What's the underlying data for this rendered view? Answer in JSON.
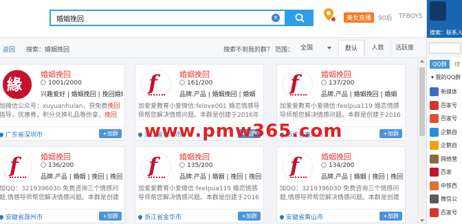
{
  "search": {
    "value": "婚姻挽回",
    "clear_icon": "clear-icon",
    "button_icon": "search-icon"
  },
  "top": {
    "live_label": "美女直播",
    "tag1": "90后",
    "tag2": "TFBOYS"
  },
  "filter": {
    "back": "返回",
    "search_crumb": "搜索：婚姻挽回",
    "not_found": "搜索不到我的群？",
    "scope_label": "范围：",
    "scope_value": "全国",
    "tabs": [
      "默认",
      "人数",
      "活跃度"
    ]
  },
  "cards": [
    {
      "title": "婚姻挽回",
      "members": "1001/2000",
      "tags": "兴趣爱好 | 婚姻挽回 | 挽回婚姻",
      "desc_a": "加微信公众号：xuyuanhulan，获免费",
      "desc_hl": "挽回",
      "desc_b": "指导，优惠券，积分兑换礼品等你拿，",
      "desc_c": "挽回",
      "desc_d": "爱情",
      "location": "广东省深圳市",
      "add": "+加群"
    },
    {
      "title": "婚姻挽回",
      "members": "161/200",
      "tags": "品牌.产品 | 婚姻挽回 | 婚姻",
      "desc_a": "加爱爱教育小爱微信:felove001 婚恋情感导师帮您解决情感问题。本群是创建于2016年的爱爱教育",
      "desc_hl": "",
      "desc_b": "",
      "desc_c": "",
      "desc_d": "",
      "location": "浙江省金华市",
      "add": "+加群"
    },
    {
      "title": "婚姻挽回",
      "members": "137/200",
      "tags": "品牌.产品 | 婚姻挽回 | 婚姻",
      "desc_a": "加爱爱教育小爱微信:feelpua119 婚恋情感导师帮您解决情感问题。本群是创建于2016年的爱爱教",
      "desc_hl": "",
      "desc_b": "",
      "desc_c": "",
      "desc_d": "",
      "location": "浙江省嘉兴市",
      "add": "+加群"
    },
    {
      "title": "婚姻挽回",
      "members": "136/200",
      "tags": "品牌.产品 | 婚姻 | 挽回 | 挽回婚姻",
      "desc_a": "加QQ：3219396030 免费咨询三个情感问题,情感导师帮您解决情感问题。本群是创建于2016年的...",
      "desc_hl": "",
      "desc_b": "",
      "desc_c": "",
      "desc_d": "",
      "location": "安徽省滁州市",
      "add": "+加群"
    },
    {
      "title": "婚姻挽回",
      "members": "135/200",
      "tags": "品牌.产品 | 婚姻 | 挽回 | 挽回婚姻",
      "desc_a": "加爱爱教育小爱微信:feelpua119 婚恋情感导师帮您解决情感问题。本群是创建于2016年的爱爱教育",
      "desc_hl": "",
      "desc_b": "",
      "desc_c": "",
      "desc_d": "",
      "location": "浙江省金华市",
      "add": "+加群"
    },
    {
      "title": "婚姻挽回",
      "members": "134/200",
      "tags": "品牌.产品 | 婚姻 | 挽回 | 挽回婚姻",
      "desc_a": "加QQ：3219396030 免费咨询三个情感问题,情感导师帮您解决情感问题。本群是创建于2016年的...",
      "desc_hl": "",
      "desc_b": "",
      "desc_c": "",
      "desc_d": "",
      "location": "安徽省黄山市",
      "add": "+加群"
    }
  ],
  "watermark": "www.pmw365.com",
  "right_panel": {
    "header_text": "搜索：联系人",
    "qq_group_tab": "QQ群",
    "disc_tab": "讨",
    "my_groups": "▾ 我的QQ群",
    "groups": [
      "新媒体",
      "百家号",
      "百家号",
      "企鹅自",
      "企鹅自",
      "网络营",
      "百家",
      "中铁西",
      "微信公",
      "百家号"
    ]
  },
  "colors": {
    "accent": "#2f9ee8",
    "title_red": "#e23b2e",
    "link_blue": "#2b78c2",
    "watermark": "#e02222"
  }
}
